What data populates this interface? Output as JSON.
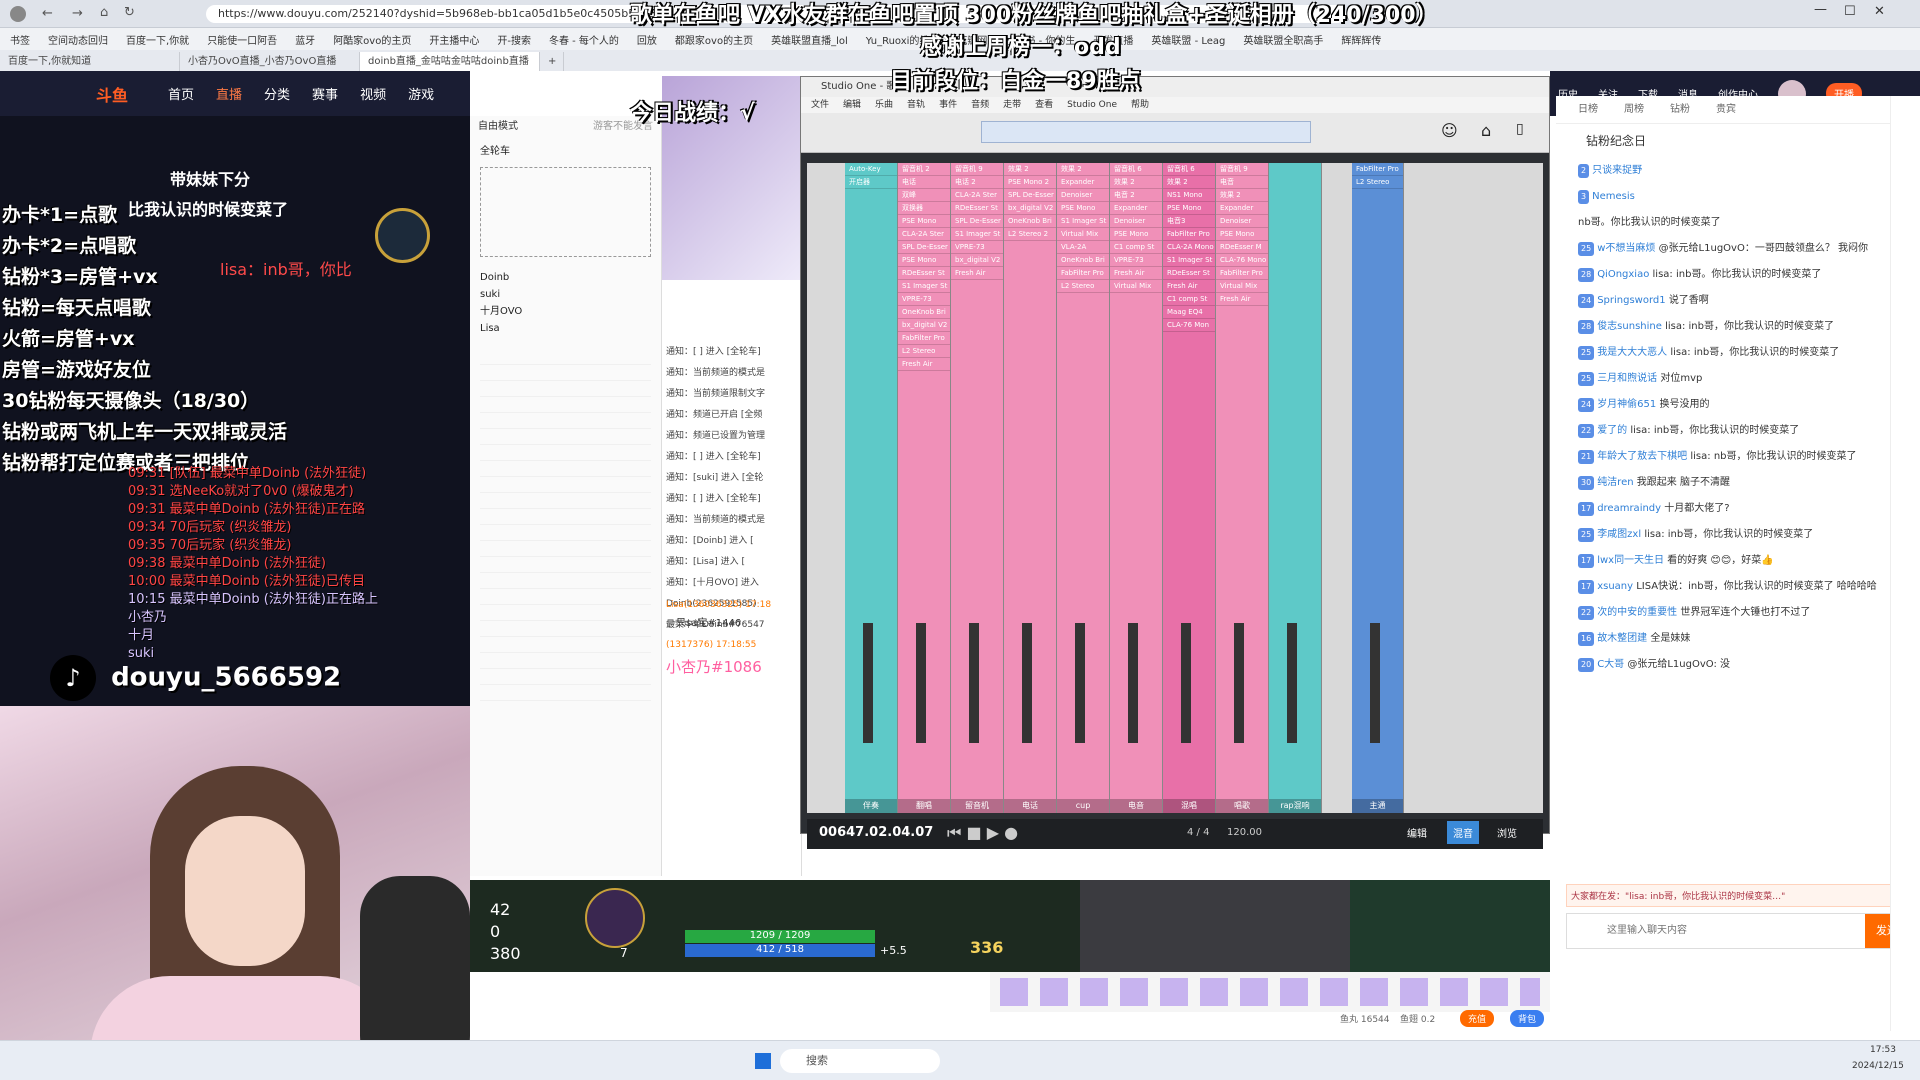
{
  "browser": {
    "url": "https://www.douyu.com/252140?dyshid=5b968eb-bb1ca05d1b5e0c4505b5423d0",
    "bookmarks": [
      "书签",
      "空间动态回归",
      "百度一下,你就",
      "只能使一口阿吾",
      "蓝牙",
      "阿酷家ovo的主页",
      "开主播中心",
      "开-搜索",
      "冬春 - 每个人的",
      "回放",
      "都跟家ovo的主页",
      "英雄联盟直播_lol",
      "Yu_Ruoxi的维护",
      "花瓣网",
      "小红书 - 你的生",
      "开发直播",
      "英雄联盟 - Leag",
      "英雄联盟全职高手",
      "辉辉辉传"
    ],
    "tabs": [
      "百度一下,你就知道",
      "小杏乃OvO直播_小杏乃OvO直播",
      "doinb直播_金咕咕金咕咕doinb直播"
    ]
  },
  "site": {
    "logo": "斗鱼",
    "nav": [
      "首页",
      "直播",
      "分类",
      "赛事",
      "视频",
      "游戏"
    ],
    "right_nav": [
      "历史",
      "关注",
      "下载",
      "消息",
      "创作中心",
      "开播"
    ]
  },
  "overlay": {
    "headline_1": "歌单在鱼吧 VX水友群在鱼吧置顶 300粉丝牌鱼吧抽礼盒+圣诞相册（240/300）",
    "headline_2": "感谢上周榜一：odd",
    "headline_3": "目前段位：白金一89胜点",
    "headline_4": "今日战绩：√",
    "rules": [
      "办卡*1=点歌",
      "办卡*2=点唱歌",
      "钻粉*3=房管+vx",
      "钻粉=每天点唱歌",
      "火箭=房管+vx",
      "房管=游戏好友位",
      "30钻粉每天摄像头（18/30）",
      "钻粉或两飞机上车一天双排或灵活",
      "钻粉帮打定位赛或者三把排位"
    ],
    "chatlog": [
      "09:31 [队伍] 最菜中单Doinb (法外狂徒)",
      "09:31 选NeeKo就对了0v0 (爆破鬼才)",
      "09:31 最菜中单Doinb (法外狂徒)正在路",
      "09:34 70后玩家 (织炎雏龙)",
      "09:35 70后玩家 (织炎雏龙)",
      "09:38 最菜中单Doinb (法外狂徒)",
      "10:00 最菜中单Doinb (法外狂徒)已传目",
      "10:15 最菜中单Doinb (法外狂徒)正在路上",
      "小杏乃",
      "十月",
      "suki"
    ],
    "subtitle": "带妹妹下分",
    "tiktok": "douyu_5666592",
    "chat_bubble_1": "比我认识的时候变菜了",
    "chat_bubble_2": "lisa：inb哥，你比"
  },
  "studio": {
    "title": "Studio One - 歌",
    "menu": [
      "文件",
      "编辑",
      "乐曲",
      "音轨",
      "事件",
      "音频",
      "走带",
      "查看",
      "Studio One",
      "帮助"
    ],
    "channels": [
      {
        "name": "伴奏",
        "color": "#5ec9c8",
        "inserts": [
          "Auto-Key",
          "开启器"
        ]
      },
      {
        "name": "翻唱",
        "color": "#f090b8",
        "inserts": [
          "留音机 2",
          "电话",
          "双峰",
          "双换器",
          "PSE Mono",
          "CLA-2A Ster",
          "SPL De-Esser",
          "PSE Mono",
          "RDeEsser St",
          "S1 Imager St",
          "VPRE-73",
          "OneKnob Bri",
          "bx_digital V2",
          "FabFilter Pro",
          "L2 Stereo",
          "Fresh Air"
        ]
      },
      {
        "name": "留音机",
        "color": "#f090b8",
        "inserts": [
          "留音机 9",
          "电话 2",
          "CLA-2A Ster",
          "RDeEsser St",
          "SPL De-Esser",
          "S1 Imager St",
          "VPRE-73",
          "bx_digital V2",
          "Fresh Air"
        ]
      },
      {
        "name": "电话",
        "color": "#f090b8",
        "inserts": [
          "效果 2",
          "PSE Mono 2",
          "SPL De-Esser",
          "bx_digital V2",
          "OneKnob Bri",
          "L2 Stereo 2"
        ]
      },
      {
        "name": "cup",
        "color": "#f090b8",
        "inserts": [
          "效果 2",
          "Expander",
          "Denoiser",
          "PSE Mono",
          "S1 Imager St",
          "Virtual Mix",
          "VLA-2A",
          "OneKnob Bri",
          "FabFilter Pro",
          "L2 Stereo"
        ]
      },
      {
        "name": "电音",
        "color": "#f090b8",
        "inserts": [
          "留音机 6",
          "效果 2",
          "电音 2",
          "Expander",
          "Denoiser",
          "PSE Mono",
          "C1 comp St",
          "VPRE-73",
          "Fresh Air",
          "Virtual Mix"
        ]
      },
      {
        "name": "混唱",
        "color": "#e870a8",
        "inserts": [
          "留音机 6",
          "效果 2",
          "NS1 Mono",
          "PSE Mono",
          "电音3",
          "FabFilter Pro",
          "CLA-2A Mono",
          "S1 Imager St",
          "RDeEsser St",
          "Fresh Air",
          "C1 comp St",
          "Maag EQ4",
          "CLA-76 Mon"
        ]
      },
      {
        "name": "唱歌",
        "color": "#f090b8",
        "inserts": [
          "留音机 9",
          "电音",
          "效果 2",
          "Expander",
          "Denoiser",
          "PSE Mono",
          "RDeEsser M",
          "CLA-76 Mono",
          "FabFilter Pro",
          "Virtual Mix",
          "Fresh Air"
        ]
      },
      {
        "name": "rap混响",
        "color": "#5ec9c8",
        "inserts": []
      },
      {
        "name": "主通",
        "color": "#5b8fd6",
        "inserts": [
          "FabFilter Pro",
          "L2 Stereo"
        ]
      }
    ],
    "transport_time": "00647.02.04.07",
    "tempo": "120.00",
    "signature": "4 / 4",
    "buttons": [
      "编辑",
      "混音",
      "浏览"
    ]
  },
  "follow_panel": {
    "mode": "自由模式",
    "right_label": "游客不能发言",
    "title": "全轮车",
    "users": [
      "Doinb",
      "suki",
      "十月OVO",
      "Lisa"
    ],
    "notice_label": "通知"
  },
  "notice_panel": {
    "items": [
      "通知：[ ] 进入 [全轮车]",
      "通知：当前频道的模式是",
      "通知：当前频道限制文字",
      "通知：频道已开启 [全频",
      "通知：频道已设置为管理",
      "通知：[ ] 进入 [全轮车]",
      "通知：[suki] 进入 [全轮",
      "通知：[ ] 进入 [全轮车]",
      "通知：当前频道的模式是",
      "通知：[Doinb] 进入 [",
      "通知：[Lisa] 进入 [",
      "通知：[十月OVO] 进入",
      "Doinb(2362591585)",
      "最菜中单Doinb#76547"
    ],
    "msg1_user": "Lisa(136036325) 17:18",
    "msg1_text": "一只sa宝#1446",
    "msg2_user": "(1317376) 17:18:55",
    "msg2_text": "小杏乃#1086"
  },
  "game_hud": {
    "hp": "1209 / 1209",
    "mp": "412 / 518",
    "regen": "+5.5",
    "gold": "336",
    "kda_1": "42",
    "kda_2": "0",
    "score": "380",
    "level": "7"
  },
  "chat": {
    "header_tabs": [
      "日榜",
      "周榜",
      "钻粉",
      "贵宾"
    ],
    "title": "钻粉纪念日",
    "lines": [
      {
        "user": "只谈来捉野",
        "text": "",
        "badge": "2"
      },
      {
        "user": "Nemesis",
        "text": "",
        "badge": "3"
      },
      {
        "user": "",
        "text": "nb哥。你比我认识的时候变菜了",
        "badge": ""
      },
      {
        "user": "w不想当麻烦",
        "text": "@张元给L1ugOvO：一哥四鼓领盘么？ 我闷你",
        "badge": "25"
      },
      {
        "user": "QiOngxiao",
        "text": "lisa: inb哥。你比我认识的时候变菜了",
        "badge": "28"
      },
      {
        "user": "Springsword1",
        "text": "说了香啊",
        "badge": "24"
      },
      {
        "user": "俊志sunshine",
        "text": "lisa: inb哥，你比我认识的时候变菜了",
        "badge": "28"
      },
      {
        "user": "我是大大大恶人",
        "text": "lisa: inb哥，你比我认识的时候变菜了",
        "badge": "25"
      },
      {
        "user": "三月和煦说话",
        "text": "对位mvp",
        "badge": "25"
      },
      {
        "user": "岁月神偷651",
        "text": "换号没用的",
        "badge": "24"
      },
      {
        "user": "爱了的",
        "text": "lisa: inb哥，你比我认识的时候变菜了",
        "badge": "22"
      },
      {
        "user": "年龄大了敖去下棋吧",
        "text": "lisa: nb哥，你比我认识的时候变菜了",
        "badge": "21"
      },
      {
        "user": "纯洁ren",
        "text": "我跟起来 脑子不清醒",
        "badge": "30"
      },
      {
        "user": "dreamraindy",
        "text": "十月都大佬了?",
        "badge": "17"
      },
      {
        "user": "李咸图zxl",
        "text": "lisa: inb哥，你比我认识的时候变菜了",
        "badge": "25"
      },
      {
        "user": "lwx同一天生日",
        "text": "看的好爽 😊😊，好菜👍",
        "badge": "17"
      },
      {
        "user": "xsuany",
        "text": "LISA快说：inb哥，你比我认识的时候变菜了 哈哈哈哈",
        "badge": "17"
      },
      {
        "user": "次的中安的重要性",
        "text": "世界冠军连个大锤也打不过了",
        "badge": "22"
      },
      {
        "user": "故木整团建",
        "text": "全是妹妹",
        "badge": "16"
      },
      {
        "user": "C大哥",
        "text": "@张元给L1ugOvO: 没",
        "badge": "20"
      }
    ],
    "input_placeholder": "这里输入聊天内容",
    "send_label": "发送",
    "tip": "大家都在发：\"lisa: inb哥，你比我认识的时候变菜…\"",
    "fish_ball": "鱼丸 16544",
    "fish_tusk": "鱼翅 0.2",
    "recharge": "充值",
    "backpack": "背包"
  },
  "taskbar": {
    "search": "搜索",
    "time": "17:53",
    "date": "2024/12/15"
  }
}
